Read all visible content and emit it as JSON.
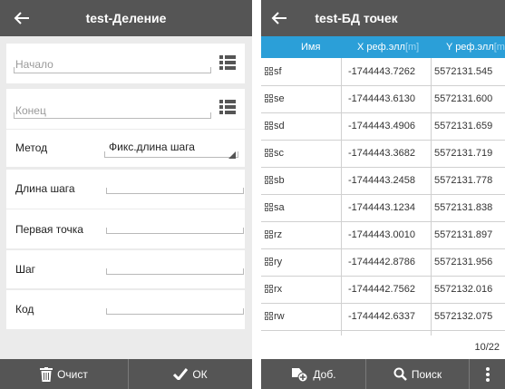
{
  "left": {
    "title": "test-Деление",
    "fields": {
      "start_placeholder": "Начало",
      "end_placeholder": "Конец",
      "method_label": "Метод",
      "method_value": "Фикс.длина шага",
      "step_length_label": "Длина шага",
      "first_point_label": "Первая точка",
      "step_label": "Шаг",
      "code_label": "Код"
    },
    "bottom": {
      "clear_label": "Очист",
      "ok_label": "ОК"
    }
  },
  "right": {
    "title": "test-БД точек",
    "columns": {
      "name": "Имя",
      "x": "X реф.элл",
      "x_unit": "[m]",
      "y": "Y реф.элл",
      "y_unit": "[m]"
    },
    "rows": [
      {
        "name": "sf",
        "x": "-1744443.7262",
        "y": "5572131.545"
      },
      {
        "name": "se",
        "x": "-1744443.6130",
        "y": "5572131.600"
      },
      {
        "name": "sd",
        "x": "-1744443.4906",
        "y": "5572131.659"
      },
      {
        "name": "sc",
        "x": "-1744443.3682",
        "y": "5572131.719"
      },
      {
        "name": "sb",
        "x": "-1744443.2458",
        "y": "5572131.778"
      },
      {
        "name": "sa",
        "x": "-1744443.1234",
        "y": "5572131.838"
      },
      {
        "name": "rz",
        "x": "-1744443.0010",
        "y": "5572131.897"
      },
      {
        "name": "ry",
        "x": "-1744442.8786",
        "y": "5572131.956"
      },
      {
        "name": "rx",
        "x": "-1744442.7562",
        "y": "5572132.016"
      },
      {
        "name": "rw",
        "x": "-1744442.6337",
        "y": "5572132.075"
      }
    ],
    "pager": "10/22",
    "bottom": {
      "add_label": "Доб.",
      "search_label": "Поиск"
    }
  }
}
